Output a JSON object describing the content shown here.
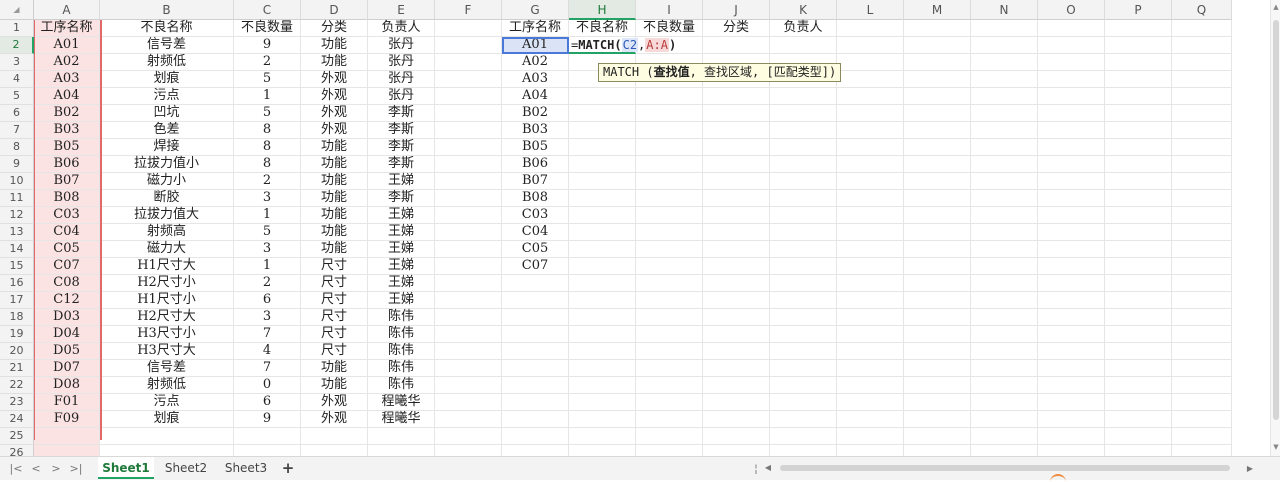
{
  "columns": [
    "A",
    "B",
    "C",
    "D",
    "E",
    "F",
    "G",
    "H",
    "I",
    "J",
    "K",
    "L",
    "M",
    "N",
    "O",
    "P",
    "Q"
  ],
  "active_column": "H",
  "active_row": 2,
  "row_numbers": [
    1,
    2,
    3,
    4,
    5,
    6,
    7,
    8,
    9,
    10,
    11,
    12,
    13,
    14,
    15,
    16,
    17,
    18,
    19,
    20,
    21,
    22,
    23,
    24,
    25,
    26
  ],
  "table1": {
    "headers": [
      "工序名称",
      "不良名称",
      "不良数量",
      "分类",
      "负责人"
    ],
    "rows": [
      [
        "A01",
        "信号差",
        "9",
        "功能",
        "张丹"
      ],
      [
        "A02",
        "射频低",
        "2",
        "功能",
        "张丹"
      ],
      [
        "A03",
        "划痕",
        "5",
        "外观",
        "张丹"
      ],
      [
        "A04",
        "污点",
        "1",
        "外观",
        "张丹"
      ],
      [
        "B02",
        "凹坑",
        "5",
        "外观",
        "李斯"
      ],
      [
        "B03",
        "色差",
        "8",
        "外观",
        "李斯"
      ],
      [
        "B05",
        "焊接",
        "8",
        "功能",
        "李斯"
      ],
      [
        "B06",
        "拉拔力值小",
        "8",
        "功能",
        "李斯"
      ],
      [
        "B07",
        "磁力小",
        "2",
        "功能",
        "王娣"
      ],
      [
        "B08",
        "断胶",
        "3",
        "功能",
        "李斯"
      ],
      [
        "C03",
        "拉拔力值大",
        "1",
        "功能",
        "王娣"
      ],
      [
        "C04",
        "射频高",
        "5",
        "功能",
        "王娣"
      ],
      [
        "C05",
        "磁力大",
        "3",
        "功能",
        "王娣"
      ],
      [
        "C07",
        "H1尺寸大",
        "1",
        "尺寸",
        "王娣"
      ],
      [
        "C08",
        "H2尺寸小",
        "2",
        "尺寸",
        "王娣"
      ],
      [
        "C12",
        "H1尺寸小",
        "6",
        "尺寸",
        "王娣"
      ],
      [
        "D03",
        "H2尺寸大",
        "3",
        "尺寸",
        "陈伟"
      ],
      [
        "D04",
        "H3尺寸小",
        "7",
        "尺寸",
        "陈伟"
      ],
      [
        "D05",
        "H3尺寸大",
        "4",
        "尺寸",
        "陈伟"
      ],
      [
        "D07",
        "信号差",
        "7",
        "功能",
        "陈伟"
      ],
      [
        "D08",
        "射频低",
        "0",
        "功能",
        "陈伟"
      ],
      [
        "F01",
        "污点",
        "6",
        "外观",
        "程曦华"
      ],
      [
        "F09",
        "划痕",
        "9",
        "外观",
        "程曦华"
      ]
    ]
  },
  "table2": {
    "headers": [
      "工序名称",
      "不良名称",
      "不良数量",
      "分类",
      "负责人"
    ],
    "codes": [
      "A01",
      "A02",
      "A03",
      "A04",
      "B02",
      "B03",
      "B05",
      "B06",
      "B07",
      "B08",
      "C03",
      "C04",
      "C05",
      "C07"
    ]
  },
  "formula": {
    "prefix": "=",
    "fn": "MATCH",
    "open": "(",
    "arg1": "C2",
    "comma": ",",
    "arg2": "A:A",
    "close": ")"
  },
  "tooltip": {
    "fn": "MATCH",
    "open": " (",
    "param1": "查找值",
    "rest": ", 查找区域, [匹配类型])"
  },
  "sheets": [
    "Sheet1",
    "Sheet2",
    "Sheet3"
  ],
  "active_sheet": "Sheet1",
  "add_sheet_label": "+",
  "nav_icons": [
    "first-icon",
    "prev-icon",
    "next-icon",
    "last-icon"
  ]
}
